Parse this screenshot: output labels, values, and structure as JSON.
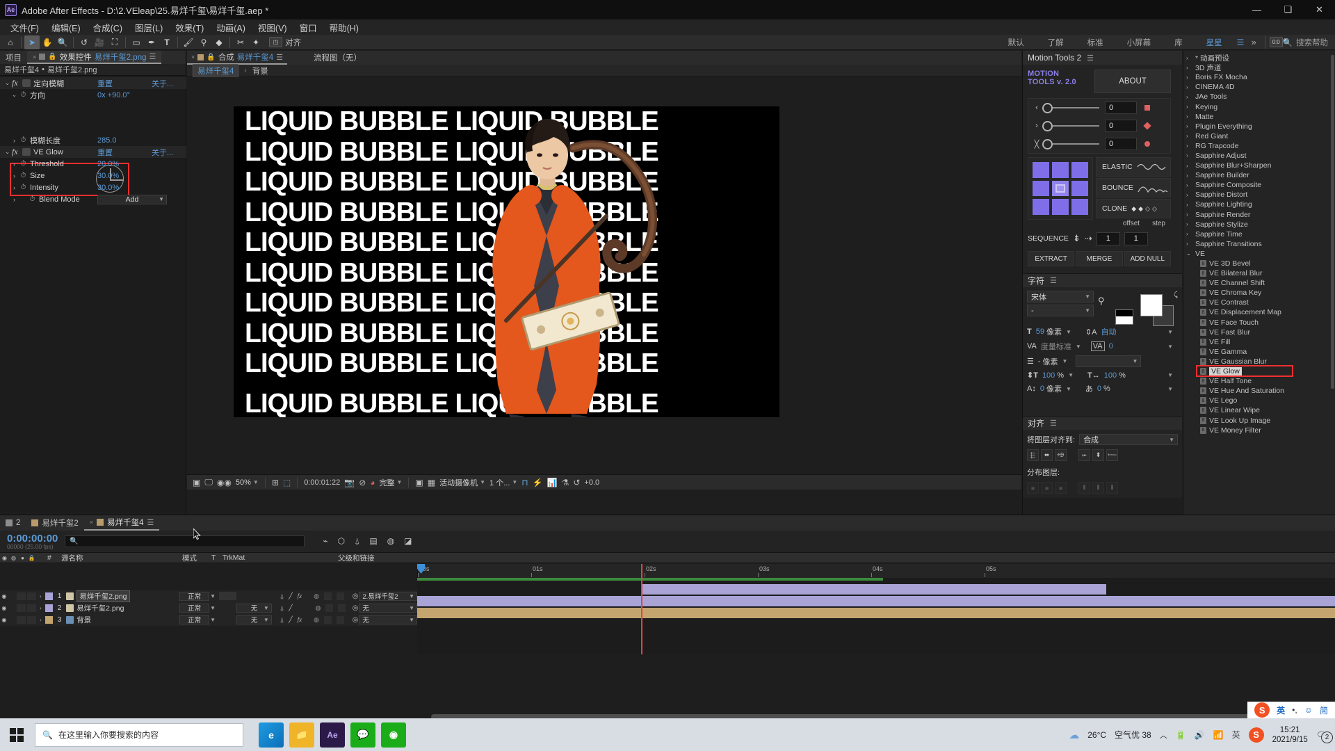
{
  "window": {
    "title": "Adobe After Effects - D:\\2.VEleap\\25.易烊千玺\\易烊千玺.aep *",
    "app_badge": "Ae",
    "minimize": "—",
    "maximize": "❑",
    "close": "✕"
  },
  "menu": [
    "文件(F)",
    "编辑(E)",
    "合成(C)",
    "图层(L)",
    "效果(T)",
    "动画(A)",
    "视图(V)",
    "窗口",
    "帮助(H)"
  ],
  "toolbar": {
    "tools": [
      "home-icon",
      "selection-icon",
      "hand-icon",
      "zoom-icon",
      "rotate-icon",
      "camera-icon",
      "anchor-icon",
      "shape-icon",
      "pen-icon",
      "text-icon",
      "brush-icon",
      "stamp-icon",
      "eraser-icon",
      "roto-icon",
      "puppet-icon"
    ],
    "align_label": "对齐",
    "workspaces": [
      "默认",
      "了解",
      "标准",
      "小屏幕",
      "库"
    ],
    "workspace_selected": "星星",
    "search_placeholder": "搜索帮助"
  },
  "effect_controls": {
    "tab_project": "项目",
    "tab_label": "效果控件",
    "tab_file": "易烊千玺2.png",
    "breadcrumb_comp": "易烊千玺4",
    "breadcrumb_layer": "易烊千玺2.png",
    "effects": [
      {
        "name": "定向模糊",
        "reset": "重置",
        "about": "关于...",
        "props": [
          {
            "name": "方向",
            "value": "0x +90.0°",
            "has_dial": true
          },
          {
            "name": "模糊长度",
            "value": "285.0"
          }
        ]
      },
      {
        "name": "VE Glow",
        "reset": "重置",
        "about": "关于...",
        "props": [
          {
            "name": "Threshold",
            "value": "20.0%"
          },
          {
            "name": "Size",
            "value": "30.0%"
          },
          {
            "name": "Intensity",
            "value": "30.0%"
          },
          {
            "name": "Blend Mode",
            "value": "Add",
            "is_select": true
          }
        ]
      }
    ],
    "highlight_color": "#f03030"
  },
  "composition": {
    "tab_label": "合成",
    "tab_name": "易烊千玺4",
    "flowchart_tab": "流程图（无）",
    "breadcrumb_comp": "易烊千玺4",
    "breadcrumb_layer": "背景",
    "canvas_text": "LIQUID BUBBLE LIQUID BUBBLE",
    "canvas_rows": 10,
    "toolbar": {
      "zoom": "50%",
      "time": "0:00:01:22",
      "resolution": "完整",
      "camera": "活动摄像机",
      "views": "1 个...",
      "exposure": "+0.0"
    }
  },
  "motion_tools": {
    "panel_title": "Motion Tools 2",
    "logo_line1": "MOTION",
    "logo_line2": "TOOLS v. 2.0",
    "about": "ABOUT",
    "sliders": [
      {
        "icon": "‹",
        "value": "0"
      },
      {
        "icon": "›",
        "value": "0"
      },
      {
        "icon": "╳",
        "value": "0"
      }
    ],
    "buttons": [
      "ELASTIC",
      "BOUNCE",
      "CLONE"
    ],
    "offset_label": "offset",
    "step_label": "step",
    "sequence_label": "SEQUENCE",
    "offset_value": "1",
    "step_value": "1",
    "bottom_buttons": [
      "EXTRACT",
      "MERGE",
      "ADD NULL"
    ],
    "accent": "#7e6fe8"
  },
  "character_panel": {
    "title": "字符",
    "font": "宋体",
    "font_style": "-",
    "size": "59",
    "size_unit": "像素",
    "leading": "自动",
    "kerning_label": "度量标准",
    "tracking": "0",
    "stroke_width": "-",
    "stroke_unit": "像素",
    "vscale": "100",
    "hscale": "100",
    "percent": "%",
    "baseline": "0",
    "baseline_unit": "像素",
    "tsume": "0",
    "tsume_unit": "%"
  },
  "align_panel": {
    "title": "对齐",
    "align_to_label": "将图层对齐到:",
    "align_to_value": "合成",
    "distribute_label": "分布图层:"
  },
  "effects_library": {
    "items": [
      {
        "label": "* 动画预设",
        "child": false
      },
      {
        "label": "3D 声道",
        "child": false
      },
      {
        "label": "Boris FX Mocha",
        "child": false
      },
      {
        "label": "CINEMA 4D",
        "child": false
      },
      {
        "label": "JAe Tools",
        "child": false
      },
      {
        "label": "Keying",
        "child": false
      },
      {
        "label": "Matte",
        "child": false
      },
      {
        "label": "Plugin Everything",
        "child": false
      },
      {
        "label": "Red Giant",
        "child": false
      },
      {
        "label": "RG Trapcode",
        "child": false
      },
      {
        "label": "Sapphire Adjust",
        "child": false
      },
      {
        "label": "Sapphire Blur+Sharpen",
        "child": false
      },
      {
        "label": "Sapphire Builder",
        "child": false
      },
      {
        "label": "Sapphire Composite",
        "child": false
      },
      {
        "label": "Sapphire Distort",
        "child": false
      },
      {
        "label": "Sapphire Lighting",
        "child": false
      },
      {
        "label": "Sapphire Render",
        "child": false
      },
      {
        "label": "Sapphire Stylize",
        "child": false
      },
      {
        "label": "Sapphire Time",
        "child": false
      },
      {
        "label": "Sapphire Transitions",
        "child": false
      },
      {
        "label": "VE",
        "child": false,
        "expanded": true
      },
      {
        "label": "VE 3D Bevel",
        "child": true
      },
      {
        "label": "VE Bilateral Blur",
        "child": true
      },
      {
        "label": "VE Channel Shift",
        "child": true
      },
      {
        "label": "VE Chroma Key",
        "child": true
      },
      {
        "label": "VE Contrast",
        "child": true
      },
      {
        "label": "VE Displacement Map",
        "child": true
      },
      {
        "label": "VE Face Touch",
        "child": true
      },
      {
        "label": "VE Fast Blur",
        "child": true
      },
      {
        "label": "VE Fill",
        "child": true
      },
      {
        "label": "VE Gamma",
        "child": true
      },
      {
        "label": "VE Gaussian Blur",
        "child": true
      },
      {
        "label": "VE Glow",
        "child": true,
        "selected": true
      },
      {
        "label": "VE Half Tone",
        "child": true
      },
      {
        "label": "VE Hue And Saturation",
        "child": true
      },
      {
        "label": "VE Lego",
        "child": true
      },
      {
        "label": "VE Linear Wipe",
        "child": true
      },
      {
        "label": "VE Look Up Image",
        "child": true
      },
      {
        "label": "VE Money Filter",
        "child": true
      }
    ]
  },
  "timeline": {
    "tabs": [
      {
        "label": "2",
        "active": false
      },
      {
        "label": "易烊千玺2",
        "active": false
      },
      {
        "label": "易烊千玺4",
        "active": true
      }
    ],
    "current_time": "0:00:00:00",
    "frame_info": "00000 (25.00 fps)",
    "search_placeholder": "",
    "columns": {
      "number": "#",
      "source_name": "源名称",
      "mode": "模式",
      "t": "T",
      "trkmat": "TrkMat",
      "parent": "父级和链接"
    },
    "layers": [
      {
        "num": "1",
        "name": "易烊千玺2.png",
        "mode": "正常",
        "trkmat": "",
        "parent": "2.易烊千玺2",
        "color": "#a9a3d6",
        "selected": true
      },
      {
        "num": "2",
        "name": "易烊千玺2.png",
        "mode": "正常",
        "trkmat": "无",
        "parent": "无",
        "color": "#a9a3d6",
        "selected": false
      },
      {
        "num": "3",
        "name": "背景",
        "mode": "正常",
        "trkmat": "无",
        "parent": "无",
        "color": "#c4a570",
        "selected": false
      }
    ],
    "ruler_ticks": [
      "00s",
      "01s",
      "02s",
      "03s",
      "04s",
      "05s"
    ]
  },
  "taskbar": {
    "search_placeholder": "在这里输入你要搜索的内容",
    "apps": [
      "edge-icon",
      "explorer-icon",
      "ae-icon",
      "wechat-icon",
      "app-icon"
    ],
    "weather_temp": "26°C",
    "air_quality": "空气优 38",
    "time": "15:21",
    "date": "2021/9/15",
    "notification_count": "2",
    "ime_lang": "英",
    "ime_mode": "简"
  }
}
